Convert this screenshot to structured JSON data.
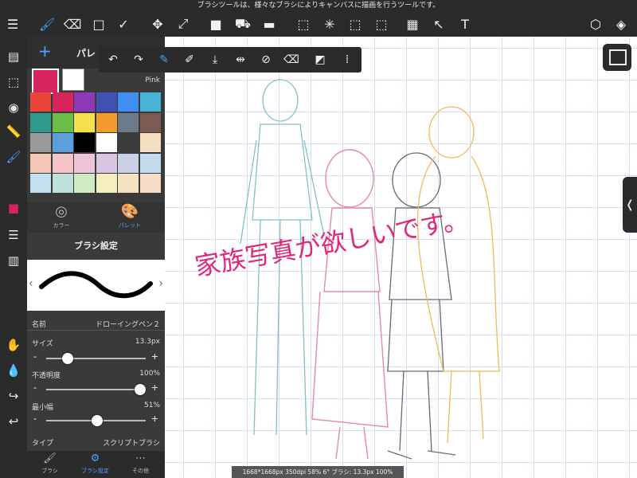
{
  "tooltip": "ブラシツールは、様々なブラシによりキャンバスに描画を行うツールです。",
  "top_tools": [
    {
      "name": "menu-icon",
      "glyph": "☰"
    },
    {
      "name": "brush-tool-icon",
      "glyph": "🖌"
    },
    {
      "name": "eraser-tool-icon",
      "glyph": "⌫"
    },
    {
      "name": "rectangle-tool-icon",
      "glyph": "□"
    },
    {
      "name": "check-tool-icon",
      "glyph": "✓"
    },
    {
      "name": "move-tool-icon",
      "glyph": "✥"
    },
    {
      "name": "transform-tool-icon",
      "glyph": "⤢"
    },
    {
      "name": "fill-color-icon",
      "glyph": "■"
    },
    {
      "name": "bucket-tool-icon",
      "glyph": "⛟"
    },
    {
      "name": "gradient-tool-icon",
      "glyph": "▬"
    },
    {
      "name": "select-rect-icon",
      "glyph": "⬚"
    },
    {
      "name": "magic-wand-icon",
      "glyph": "✳"
    },
    {
      "name": "select-pen-icon",
      "glyph": "⬚"
    },
    {
      "name": "select-eraser-icon",
      "glyph": "⬚"
    },
    {
      "name": "frame-tool-icon",
      "glyph": "▦"
    },
    {
      "name": "operation-tool-icon",
      "glyph": "↖"
    },
    {
      "name": "text-tool-icon",
      "glyph": "T"
    },
    {
      "name": "materials-icon",
      "glyph": "⬡"
    },
    {
      "name": "layers-icon",
      "glyph": "◈"
    }
  ],
  "left_tools": [
    {
      "name": "layers-panel-icon",
      "glyph": "▤"
    },
    {
      "name": "selection-icon",
      "glyph": "⬚"
    },
    {
      "name": "rotate-icon",
      "glyph": "◉"
    },
    {
      "name": "ruler-icon",
      "glyph": "📏"
    },
    {
      "name": "brush-panel-icon",
      "glyph": "🖌"
    },
    {
      "name": "color-panel-icon",
      "glyph": "■"
    },
    {
      "name": "list-icon",
      "glyph": "☰"
    },
    {
      "name": "palette-strip-icon",
      "glyph": "▥"
    },
    {
      "name": "hand-icon",
      "glyph": "✋"
    },
    {
      "name": "eyedropper-icon",
      "glyph": "💧"
    },
    {
      "name": "redo-icon",
      "glyph": "↪"
    },
    {
      "name": "undo-icon",
      "glyph": "↩"
    }
  ],
  "palette_panel": {
    "add_label": "+",
    "title": "パレ",
    "color_name": "Pink",
    "colors": [
      "#e8453c",
      "#d6245c",
      "#8e3ab8",
      "#3f51b5",
      "#3f8ef0",
      "#48b3d6",
      "#2e9a8c",
      "#6cbd45",
      "#f4e04a",
      "#f39a2c",
      "#6b7b8a",
      "#7a5a52",
      "#9b9b9b",
      "#5aa0dc",
      "#000000",
      "#ffffff",
      "#3c3c3c",
      "#f6dfc0",
      "#f4c7b8",
      "#f5c2c8",
      "#efc6d8",
      "#d8c6e2",
      "#c9cfe6",
      "#c2dceb",
      "#c2e0f0",
      "#bfe0da",
      "#d0ebc4",
      "#f5efbe",
      "#f4e2c0",
      "#f6dcc8"
    ],
    "tab_color": "カラー",
    "tab_palette": "パレット"
  },
  "brush_settings": {
    "title": "ブラシ設定",
    "name_label": "名前",
    "name_value": "ドローイングペン２",
    "size_label": "サイズ",
    "size_value": "13.3px",
    "size_level": 0.18,
    "opacity_label": "不透明度",
    "opacity_value": "100%",
    "opacity_level": 1.0,
    "minwidth_label": "最小幅",
    "minwidth_value": "51%",
    "minwidth_level": 0.51,
    "type_label": "タイプ",
    "type_value": "スクリプトブラシ",
    "minus": "-",
    "plus": "+"
  },
  "bottom_tabs": [
    {
      "name": "tab-brush",
      "glyph": "🖌",
      "label": "ブラシ"
    },
    {
      "name": "tab-brush-settings",
      "glyph": "⚙",
      "label": "ブラシ設定"
    },
    {
      "name": "tab-more",
      "glyph": "⋯",
      "label": "その他"
    }
  ],
  "float_tools": [
    {
      "name": "undo-float-icon",
      "glyph": "↶"
    },
    {
      "name": "redo-float-icon",
      "glyph": "↷"
    },
    {
      "name": "brush-float-icon",
      "glyph": "✎"
    },
    {
      "name": "pen-float-icon",
      "glyph": "✐"
    },
    {
      "name": "download-float-icon",
      "glyph": "⤓"
    },
    {
      "name": "flip-float-icon",
      "glyph": "⇹"
    },
    {
      "name": "no-snap-float-icon",
      "glyph": "⊘"
    },
    {
      "name": "eraser-float-icon",
      "glyph": "⌫"
    },
    {
      "name": "fill-float-icon",
      "glyph": "◩"
    },
    {
      "name": "grid-float-icon",
      "glyph": "⁞"
    }
  ],
  "canvas_text": "家族写真が欲しいです。",
  "status_text": "1668*1668px 350dpi 58% 6° ブラシ: 13.3px 100%",
  "side_handle": "❬",
  "colors": {
    "main": "#d6245c",
    "accent": "#3f8ef0",
    "ui_dark": "#2b2b2b"
  }
}
